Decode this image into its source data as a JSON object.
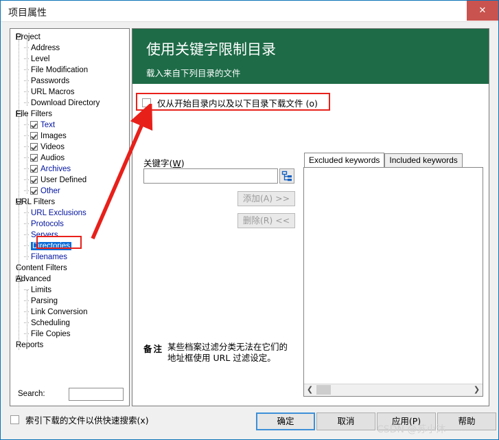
{
  "window": {
    "title": "项目属性",
    "close_label": "✕"
  },
  "colors": {
    "header_green": "#1d6b47",
    "selection_blue": "#0a6bd6",
    "tree_link_blue": "#00129e",
    "annotation_red": "#e8201a",
    "close_red": "#c9534e",
    "focus_blue": "#3d8fd8"
  },
  "tree": {
    "nodes": [
      {
        "label": "Project",
        "depth": 0,
        "expander": true,
        "checkbox": false,
        "blue": false,
        "selected": false
      },
      {
        "label": "Address",
        "depth": 1,
        "expander": false,
        "checkbox": false,
        "blue": false,
        "selected": false
      },
      {
        "label": "Level",
        "depth": 1,
        "expander": false,
        "checkbox": false,
        "blue": false,
        "selected": false
      },
      {
        "label": "File Modification",
        "depth": 1,
        "expander": false,
        "checkbox": false,
        "blue": false,
        "selected": false
      },
      {
        "label": "Passwords",
        "depth": 1,
        "expander": false,
        "checkbox": false,
        "blue": false,
        "selected": false
      },
      {
        "label": "URL Macros",
        "depth": 1,
        "expander": false,
        "checkbox": false,
        "blue": false,
        "selected": false
      },
      {
        "label": "Download Directory",
        "depth": 1,
        "expander": false,
        "checkbox": false,
        "blue": false,
        "selected": false
      },
      {
        "label": "File Filters",
        "depth": 0,
        "expander": true,
        "checkbox": false,
        "blue": false,
        "selected": false
      },
      {
        "label": "Text",
        "depth": 1,
        "expander": false,
        "checkbox": true,
        "blue": true,
        "selected": false
      },
      {
        "label": "Images",
        "depth": 1,
        "expander": false,
        "checkbox": true,
        "blue": false,
        "selected": false
      },
      {
        "label": "Videos",
        "depth": 1,
        "expander": false,
        "checkbox": true,
        "blue": false,
        "selected": false
      },
      {
        "label": "Audios",
        "depth": 1,
        "expander": false,
        "checkbox": true,
        "blue": false,
        "selected": false
      },
      {
        "label": "Archives",
        "depth": 1,
        "expander": false,
        "checkbox": true,
        "blue": true,
        "selected": false
      },
      {
        "label": "User Defined",
        "depth": 1,
        "expander": false,
        "checkbox": true,
        "blue": false,
        "selected": false
      },
      {
        "label": "Other",
        "depth": 1,
        "expander": false,
        "checkbox": true,
        "blue": true,
        "selected": false
      },
      {
        "label": "URL Filters",
        "depth": 0,
        "expander": true,
        "checkbox": false,
        "blue": false,
        "selected": false
      },
      {
        "label": "URL Exclusions",
        "depth": 1,
        "expander": false,
        "checkbox": false,
        "blue": true,
        "selected": false
      },
      {
        "label": "Protocols",
        "depth": 1,
        "expander": false,
        "checkbox": false,
        "blue": true,
        "selected": false
      },
      {
        "label": "Servers",
        "depth": 1,
        "expander": false,
        "checkbox": false,
        "blue": true,
        "selected": false
      },
      {
        "label": "Directories",
        "depth": 1,
        "expander": false,
        "checkbox": false,
        "blue": true,
        "selected": true
      },
      {
        "label": "Filenames",
        "depth": 1,
        "expander": false,
        "checkbox": false,
        "blue": true,
        "selected": false
      },
      {
        "label": "Content Filters",
        "depth": 0,
        "expander": false,
        "checkbox": false,
        "blue": false,
        "selected": false
      },
      {
        "label": "Advanced",
        "depth": 0,
        "expander": true,
        "checkbox": false,
        "blue": false,
        "selected": false
      },
      {
        "label": "Limits",
        "depth": 1,
        "expander": false,
        "checkbox": false,
        "blue": false,
        "selected": false
      },
      {
        "label": "Parsing",
        "depth": 1,
        "expander": false,
        "checkbox": false,
        "blue": false,
        "selected": false
      },
      {
        "label": "Link Conversion",
        "depth": 1,
        "expander": false,
        "checkbox": false,
        "blue": false,
        "selected": false
      },
      {
        "label": "Scheduling",
        "depth": 1,
        "expander": false,
        "checkbox": false,
        "blue": false,
        "selected": false
      },
      {
        "label": "File Copies",
        "depth": 1,
        "expander": false,
        "checkbox": false,
        "blue": false,
        "selected": false
      },
      {
        "label": "Reports",
        "depth": 0,
        "expander": false,
        "checkbox": false,
        "blue": false,
        "selected": false
      }
    ]
  },
  "search": {
    "label": "Search:",
    "value": "",
    "placeholder": ""
  },
  "header": {
    "title": "使用关键字限制目录",
    "subtitle": "载入来自下列目录的文件"
  },
  "top_checkbox": {
    "label": "仅从开始目录内以及以下目录下载文件 (o)",
    "checked": false
  },
  "keyword": {
    "label_prefix": "关键字(",
    "label_key": "W",
    "label_suffix": ")",
    "value": "",
    "placeholder": "",
    "picker_icon": "tree-hierarchy-icon",
    "add_button": "添加(A) >>",
    "delete_button": "删除(R) <<",
    "add_enabled": false,
    "delete_enabled": false
  },
  "note": {
    "label": "备注",
    "text": "某些档案过滤分类无法在它们的地址框使用 URL 过滤设定。"
  },
  "tabs": [
    {
      "label": "Excluded keywords",
      "active": true
    },
    {
      "label": "Included keywords",
      "active": false
    }
  ],
  "keyword_list": {
    "items": [],
    "scroll_left_icon": "❮",
    "scroll_right_icon": "❯"
  },
  "index_checkbox": {
    "label": "索引下载的文件以供快速搜索(x)",
    "checked": false
  },
  "dialog_buttons": [
    {
      "label": "确定",
      "primary": true
    },
    {
      "label": "取消",
      "primary": false
    },
    {
      "label": "应用(P)",
      "primary": false
    },
    {
      "label": "帮助",
      "primary": false
    }
  ],
  "watermark": "CSDN @苏小沐"
}
